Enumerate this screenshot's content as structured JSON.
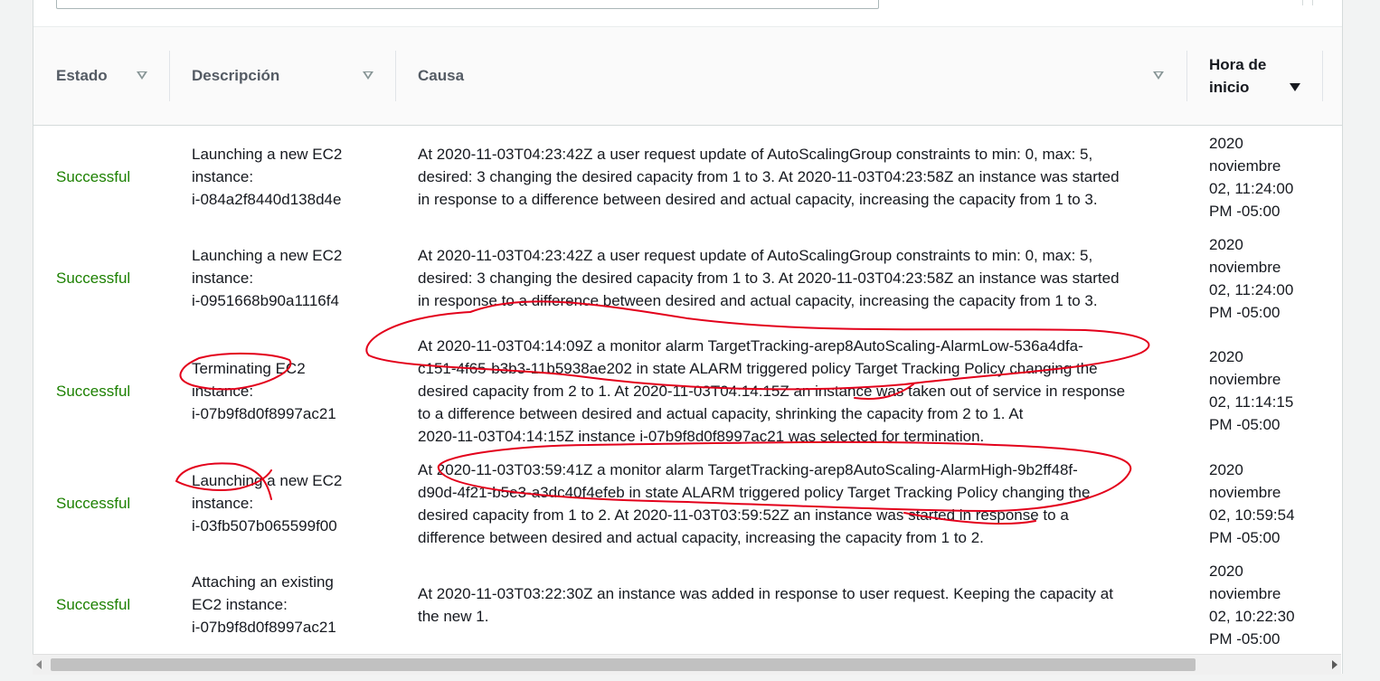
{
  "table": {
    "columns": {
      "estado": "Estado",
      "descripcion": "Descripción",
      "causa": "Causa",
      "hora_line1": "Hora de",
      "hora_line2": "inicio"
    },
    "rows": [
      {
        "status": "Successful",
        "desc": [
          "Launching a new EC2",
          "instance:",
          "i-084a2f8440d138d4e"
        ],
        "cause": [
          "At 2020-11-03T04:23:42Z a user request update of AutoScalingGroup constraints to min: 0, max: 5,",
          "desired: 3 changing the desired capacity from 1 to 3. At 2020-11-03T04:23:58Z an instance was started",
          "in response to a difference between desired and actual capacity, increasing the capacity from 1 to 3."
        ],
        "time": [
          "2020",
          "noviembre",
          "02, 11:24:00",
          "PM -05:00"
        ]
      },
      {
        "status": "Successful",
        "desc": [
          "Launching a new EC2",
          "instance:",
          "i-0951668b90a1116f4"
        ],
        "cause": [
          "At 2020-11-03T04:23:42Z a user request update of AutoScalingGroup constraints to min: 0, max: 5,",
          "desired: 3 changing the desired capacity from 1 to 3. At 2020-11-03T04:23:58Z an instance was started",
          "in response to a difference between desired and actual capacity, increasing the capacity from 1 to 3."
        ],
        "time": [
          "2020",
          "noviembre",
          "02, 11:24:00",
          "PM -05:00"
        ]
      },
      {
        "status": "Successful",
        "desc": [
          "Terminating EC2",
          "instance:",
          "i-07b9f8d0f8997ac21"
        ],
        "cause": [
          "At 2020-11-03T04:14:09Z a monitor alarm TargetTracking-arep8AutoScaling-AlarmLow-536a4dfa-",
          "c151-4f65-b3b3-11b5938ae202 in state ALARM triggered policy Target Tracking Policy changing the",
          "desired capacity from 2 to 1. At 2020-11-03T04:14:15Z an instance was taken out of service in response",
          "to a difference between desired and actual capacity, shrinking the capacity from 2 to 1. At",
          "2020-11-03T04:14:15Z instance i-07b9f8d0f8997ac21 was selected for termination."
        ],
        "time": [
          "2020",
          "noviembre",
          "02, 11:14:15",
          "PM -05:00"
        ]
      },
      {
        "status": "Successful",
        "desc": [
          "Launching a new EC2",
          "instance:",
          "i-03fb507b065599f00"
        ],
        "cause": [
          "At 2020-11-03T03:59:41Z a monitor alarm TargetTracking-arep8AutoScaling-AlarmHigh-9b2ff48f-",
          "d90d-4f21-b5e3-a3dc40f4efeb in state ALARM triggered policy Target Tracking Policy changing the",
          "desired capacity from 1 to 2. At 2020-11-03T03:59:52Z an instance was started in response to a",
          "difference between desired and actual capacity, increasing the capacity from 1 to 2."
        ],
        "time": [
          "2020",
          "noviembre",
          "02, 10:59:54",
          "PM -05:00"
        ]
      },
      {
        "status": "Successful",
        "desc": [
          "Attaching an existing",
          "EC2 instance:",
          "i-07b9f8d0f8997ac21"
        ],
        "cause": [
          "At 2020-11-03T03:22:30Z an instance was added in response to user request. Keeping the capacity at",
          "the new 1."
        ],
        "time": [
          "2020",
          "noviembre",
          "02, 10:22:30",
          "PM -05:00"
        ]
      }
    ]
  },
  "colors": {
    "success": "#1d8102",
    "annotation": "#e3001b"
  }
}
